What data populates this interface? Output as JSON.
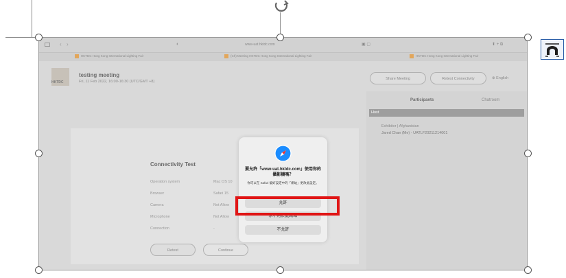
{
  "browser": {
    "url": "www-uat.hktdc.com",
    "tabs": [
      "HKTDC Hong Kong International Lighting Fair",
      "(Ch) Meeting HKTDC Hong Kong International Lighting Fair",
      "HKTDC Hong Kong International Lighting Fair"
    ]
  },
  "meeting": {
    "title": "testing meeting",
    "datetime": "Fri, 11 Feb 2022, 16:00-16:30 (UTC/GMT +8)",
    "logo_text": "HKTDC",
    "buttons": {
      "share": "Share Meeting",
      "retest": "Retest Connectivity",
      "language": "English"
    }
  },
  "connectivity": {
    "title": "Connectivity Test",
    "rows": [
      {
        "label": "Operation system",
        "value": "Mac OS 10"
      },
      {
        "label": "Browser",
        "value": "Safari 15"
      },
      {
        "label": "Camera",
        "value": "Not Allow"
      },
      {
        "label": "Microphone",
        "value": "Not Allow"
      },
      {
        "label": "Connection",
        "value": "-"
      }
    ],
    "retest": "Retest",
    "continue": "Continue"
  },
  "sidebar": {
    "tabs": [
      "Participants",
      "Chatroom"
    ],
    "section": "Host",
    "participant_line1": "Exhibitor | Afghanistan",
    "participant_line2": "Jared Chan (Me) - UATLF20211214001"
  },
  "dialog": {
    "title": "要允許「www-uat.hktdc.com」使用你的攝影機嗎？",
    "message": "你可以在 Safari 偏好設定中的「網站」更改此設定。",
    "allow": "允許",
    "never": "永不用於此網站",
    "deny": "不允許"
  },
  "editor": {
    "layout_icon": "layout-options-icon",
    "rotate_icon": "rotate-handle-icon"
  },
  "colors": {
    "highlight": "#e01515",
    "safari": "#1a8cff"
  }
}
